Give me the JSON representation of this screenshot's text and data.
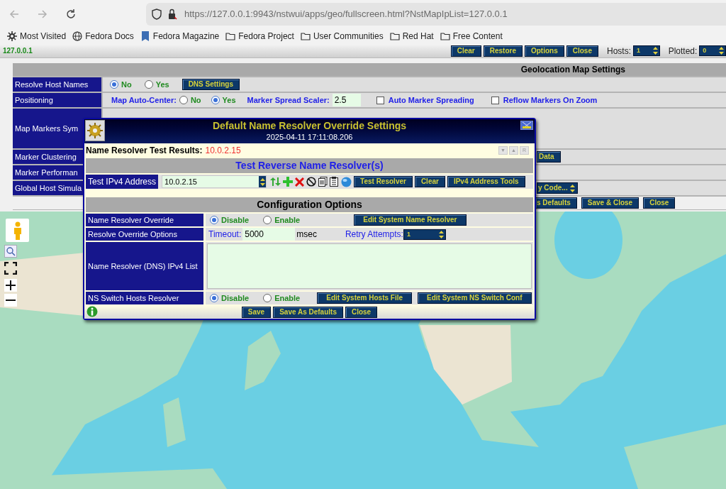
{
  "browser": {
    "url": "https://127.0.0.1:9943/nstwui/apps/geo/fullscreen.html?NstMapIpList=127.0.0.1",
    "bookmarks": [
      {
        "label": "Most Visited"
      },
      {
        "label": "Fedora Docs"
      },
      {
        "label": "Fedora Magazine"
      },
      {
        "label": "Fedora Project"
      },
      {
        "label": "User Communities"
      },
      {
        "label": "Red Hat"
      },
      {
        "label": "Free Content"
      }
    ]
  },
  "toolbar": {
    "host": "127.0.0.1",
    "buttons": [
      "Clear",
      "Restore",
      "Options",
      "Close"
    ],
    "hosts": {
      "label": "Hosts:",
      "value": "1"
    },
    "plotted": {
      "label": "Plotted:",
      "value": "0"
    }
  },
  "settings": {
    "title": "Geolocation Map Settings",
    "rows": [
      {
        "label": "Resolve Host Names",
        "kind": "radios",
        "options": [
          {
            "label": "No",
            "selected": true
          },
          {
            "label": "Yes",
            "selected": false
          }
        ],
        "button": "DNS Settings"
      },
      {
        "label": "Positioning",
        "kind": "positioning",
        "auto_center": {
          "label": "Map Auto-Center:",
          "options": [
            {
              "label": "No",
              "selected": false
            },
            {
              "label": "Yes",
              "selected": true
            }
          ]
        },
        "spread": {
          "label": "Marker Spread Scaler:",
          "value": "2.5"
        },
        "checkboxes": [
          {
            "label": "Auto Marker Spreading",
            "checked": false
          },
          {
            "label": "Reflow Markers On Zoom",
            "checked": false
          }
        ]
      },
      {
        "label": "Map Markers Sym",
        "kind": "blank"
      },
      {
        "label": "Marker Clustering",
        "kind": "button",
        "text": "Data"
      },
      {
        "label": "Marker Performan",
        "kind": "blank"
      },
      {
        "label": "Global Host Simula",
        "kind": "select",
        "text": "y Code..."
      }
    ],
    "buttons": [
      "s Defaults",
      "Save & Close",
      "Close"
    ]
  },
  "dialog": {
    "title": "Default Name Resolver Override Settings",
    "timestamp": "2025-04-11 17:11:08.206",
    "results": {
      "label": "Name Resolver Test Results:",
      "value": "10.0.2.15",
      "controls": [
        "▼",
        "▲",
        "R"
      ]
    },
    "test_heading": "Test Reverse Name Resolver(s)",
    "test": {
      "label": "Test IPv4 Address",
      "value": "10.0.2.15",
      "buttons": [
        "Test Resolver",
        "Clear",
        "IPv4 Address Tools"
      ]
    },
    "config_heading": "Configuration Options",
    "config": [
      {
        "label": "Name Resolver Override",
        "kind": "radios",
        "options": [
          {
            "label": "Disable",
            "selected": true
          },
          {
            "label": "Enable",
            "selected": false
          }
        ],
        "buttons": [
          "Edit System Name Resolver"
        ]
      },
      {
        "label": "Resolve Override Options",
        "kind": "timeout",
        "timeout_label": "Timeout:",
        "timeout": "5000",
        "unit": "msec",
        "retry_label": "Retry Attempts:",
        "retry": "1"
      },
      {
        "label": "Name Resolver (DNS) IPv4 List",
        "kind": "textarea"
      },
      {
        "label": "NS Switch Hosts Resolver",
        "kind": "radios",
        "options": [
          {
            "label": "Disable",
            "selected": true
          },
          {
            "label": "Enable",
            "selected": false
          }
        ],
        "buttons": [
          "Edit System Hosts File",
          "Edit System NS Switch Conf"
        ]
      }
    ],
    "buttons": [
      "Save",
      "Save As Defaults",
      "Close"
    ]
  }
}
